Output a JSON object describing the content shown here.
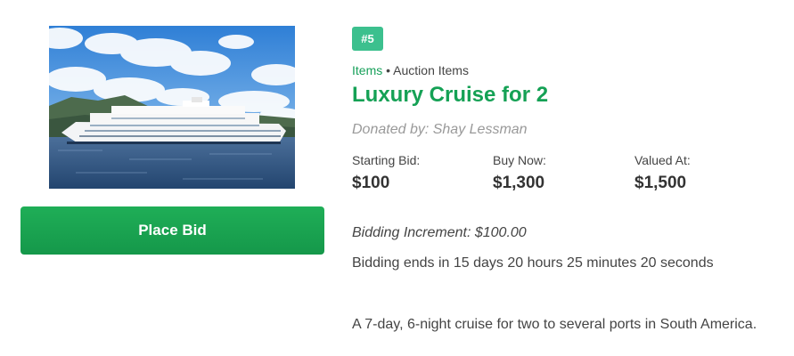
{
  "item": {
    "image_alt": "Luxury cruise ship on the water",
    "number_badge": "#5",
    "breadcrumb": {
      "category": "Items",
      "separator": "•",
      "subcategory": "Auction Items"
    },
    "title": "Luxury Cruise for 2",
    "donated_by": "Donated by: Shay Lessman",
    "prices": [
      {
        "label": "Starting Bid:",
        "value": "$100"
      },
      {
        "label": "Buy Now:",
        "value": "$1,300"
      },
      {
        "label": "Valued At:",
        "value": "$1,500"
      }
    ],
    "bidding_increment": "Bidding Increment: $100.00",
    "bidding_ends": "Bidding ends in 15 days 20 hours 25 minutes 20 seconds",
    "description": "A 7-day, 6-night cruise for two to several ports in South America."
  },
  "actions": {
    "place_bid_label": "Place Bid"
  },
  "colors": {
    "accent_green": "#15a155",
    "button_green": "#1aa354",
    "badge_teal": "#3cc08e"
  }
}
